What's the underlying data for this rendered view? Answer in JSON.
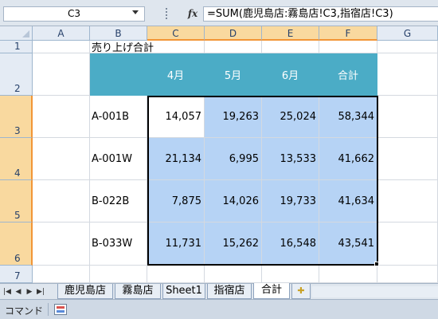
{
  "formula_bar": {
    "name_box": "C3",
    "fx_label": "fx",
    "formula": "=SUM(鹿児島店:霧島店!C3,指宿店!C3)"
  },
  "columns": [
    "A",
    "B",
    "C",
    "D",
    "E",
    "F",
    "G"
  ],
  "rows": [
    "1",
    "2",
    "3",
    "4",
    "5",
    "6",
    "7"
  ],
  "sheet": {
    "title": "売り上げ合計",
    "header": [
      "4月",
      "5月",
      "6月",
      "合計"
    ],
    "data": [
      {
        "code": "A-001B",
        "values": [
          "14,057",
          "19,263",
          "25,024",
          "58,344"
        ]
      },
      {
        "code": "A-001W",
        "values": [
          "21,134",
          "6,995",
          "13,533",
          "41,662"
        ]
      },
      {
        "code": "B-022B",
        "values": [
          "7,875",
          "14,026",
          "19,733",
          "41,634"
        ]
      },
      {
        "code": "B-033W",
        "values": [
          "11,731",
          "15,262",
          "16,548",
          "43,541"
        ]
      }
    ]
  },
  "tabs": [
    "鹿児島店",
    "霧島店",
    "Sheet1",
    "指宿店",
    "合計"
  ],
  "active_tab": "合計",
  "status": {
    "mode": "コマンド"
  },
  "colors": {
    "header_fill": "#4bacc6",
    "selection_fill": "#b6d3f5",
    "selected_header": "#f9d99f"
  }
}
